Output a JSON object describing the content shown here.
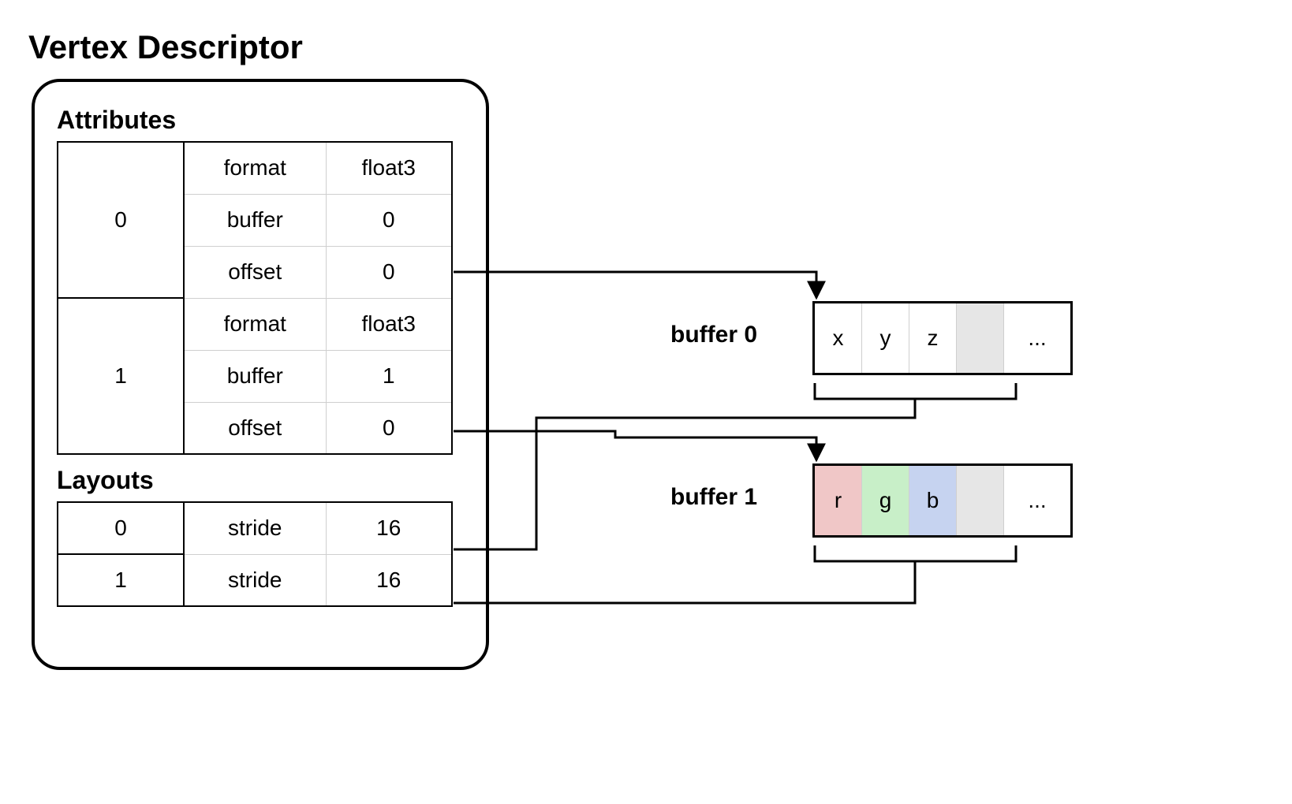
{
  "title": "Vertex Descriptor",
  "attributes_heading": "Attributes",
  "layouts_heading": "Layouts",
  "attributes": [
    {
      "index": "0",
      "format_k": "format",
      "format_v": "float3",
      "buffer_k": "buffer",
      "buffer_v": "0",
      "offset_k": "offset",
      "offset_v": "0"
    },
    {
      "index": "1",
      "format_k": "format",
      "format_v": "float3",
      "buffer_k": "buffer",
      "buffer_v": "1",
      "offset_k": "offset",
      "offset_v": "0"
    }
  ],
  "layouts": [
    {
      "index": "0",
      "stride_k": "stride",
      "stride_v": "16"
    },
    {
      "index": "1",
      "stride_k": "stride",
      "stride_v": "16"
    }
  ],
  "buffers": [
    {
      "label": "buffer 0",
      "cells": [
        "x",
        "y",
        "z"
      ],
      "dots": "..."
    },
    {
      "label": "buffer 1",
      "cells": [
        "r",
        "g",
        "b"
      ],
      "dots": "..."
    }
  ]
}
